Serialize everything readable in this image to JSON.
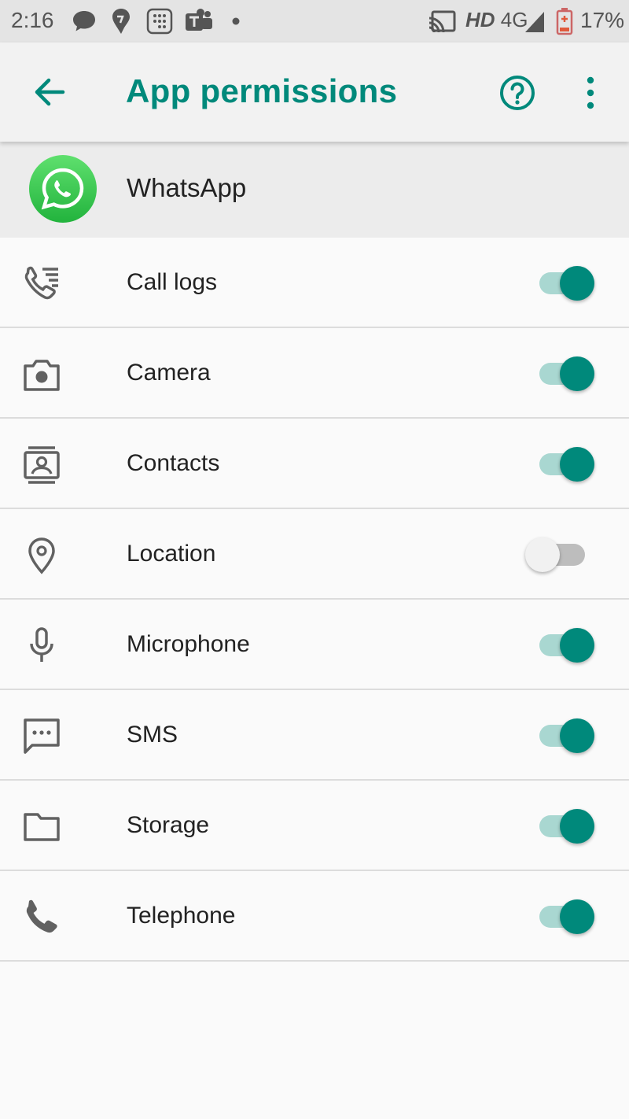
{
  "status_bar": {
    "time": "2:16",
    "network_hd": "HD",
    "network_gen": "4G",
    "battery_percent": "17%",
    "icons": [
      "message-icon",
      "swiggy-icon",
      "dialpad-app-icon",
      "teams-icon",
      "notification-dot-icon",
      "cast-icon",
      "signal-icon",
      "battery-icon"
    ]
  },
  "app_bar": {
    "title": "App permissions",
    "back_icon": "arrow-back-icon",
    "help_icon": "help-circle-icon",
    "more_icon": "more-vert-icon"
  },
  "app": {
    "name": "WhatsApp",
    "icon": "whatsapp-logo-icon"
  },
  "colors": {
    "accent": "#00897b",
    "track_on": "#a9d7d1",
    "track_off": "#bdbdbd",
    "thumb_off": "#f1f1f1",
    "whatsapp_green": "#2fc84e"
  },
  "permissions": [
    {
      "label": "Call logs",
      "icon": "call-log-icon",
      "enabled": true
    },
    {
      "label": "Camera",
      "icon": "camera-icon",
      "enabled": true
    },
    {
      "label": "Contacts",
      "icon": "contacts-icon",
      "enabled": true
    },
    {
      "label": "Location",
      "icon": "location-pin-icon",
      "enabled": false
    },
    {
      "label": "Microphone",
      "icon": "microphone-icon",
      "enabled": true
    },
    {
      "label": "SMS",
      "icon": "sms-icon",
      "enabled": true
    },
    {
      "label": "Storage",
      "icon": "folder-icon",
      "enabled": true
    },
    {
      "label": "Telephone",
      "icon": "phone-icon",
      "enabled": true
    }
  ]
}
